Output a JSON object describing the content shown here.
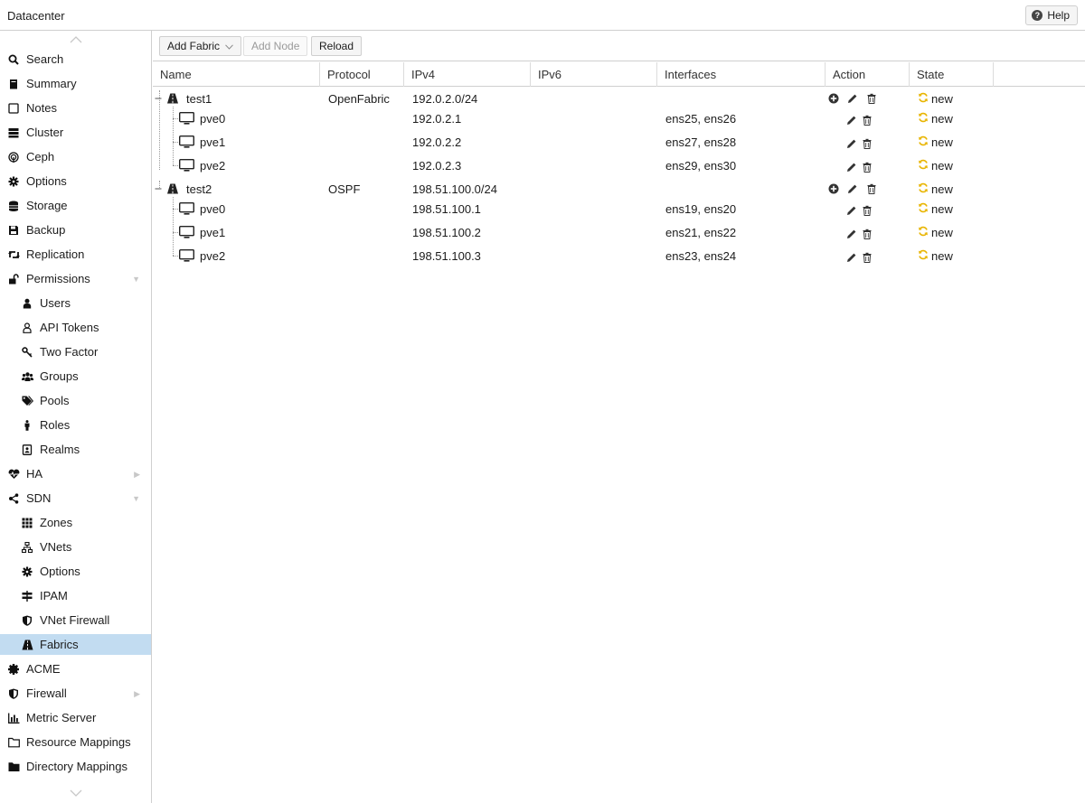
{
  "header": {
    "title": "Datacenter",
    "help_label": "Help"
  },
  "sidebar": {
    "items": [
      {
        "label": "Search"
      },
      {
        "label": "Summary"
      },
      {
        "label": "Notes"
      },
      {
        "label": "Cluster"
      },
      {
        "label": "Ceph"
      },
      {
        "label": "Options"
      },
      {
        "label": "Storage"
      },
      {
        "label": "Backup"
      },
      {
        "label": "Replication"
      },
      {
        "label": "Permissions"
      },
      {
        "label": "Users"
      },
      {
        "label": "API Tokens"
      },
      {
        "label": "Two Factor"
      },
      {
        "label": "Groups"
      },
      {
        "label": "Pools"
      },
      {
        "label": "Roles"
      },
      {
        "label": "Realms"
      },
      {
        "label": "HA"
      },
      {
        "label": "SDN"
      },
      {
        "label": "Zones"
      },
      {
        "label": "VNets"
      },
      {
        "label": "Options"
      },
      {
        "label": "IPAM"
      },
      {
        "label": "VNet Firewall"
      },
      {
        "label": "Fabrics"
      },
      {
        "label": "ACME"
      },
      {
        "label": "Firewall"
      },
      {
        "label": "Metric Server"
      },
      {
        "label": "Resource Mappings"
      },
      {
        "label": "Directory Mappings"
      }
    ]
  },
  "toolbar": {
    "add_fabric": "Add Fabric",
    "add_node": "Add Node",
    "reload": "Reload"
  },
  "grid": {
    "columns": [
      "Name",
      "Protocol",
      "IPv4",
      "IPv6",
      "Interfaces",
      "Action",
      "State"
    ],
    "rows": [
      {
        "name": "test1",
        "protocol": "OpenFabric",
        "ipv4": "192.0.2.0/24",
        "ipv6": "",
        "interfaces": "",
        "state": "new"
      },
      {
        "name": "pve0",
        "protocol": "",
        "ipv4": "192.0.2.1",
        "ipv6": "",
        "interfaces": "ens25, ens26",
        "state": "new"
      },
      {
        "name": "pve1",
        "protocol": "",
        "ipv4": "192.0.2.2",
        "ipv6": "",
        "interfaces": "ens27, ens28",
        "state": "new"
      },
      {
        "name": "pve2",
        "protocol": "",
        "ipv4": "192.0.2.3",
        "ipv6": "",
        "interfaces": "ens29, ens30",
        "state": "new"
      },
      {
        "name": "test2",
        "protocol": "OSPF",
        "ipv4": "198.51.100.0/24",
        "ipv6": "",
        "interfaces": "",
        "state": "new"
      },
      {
        "name": "pve0",
        "protocol": "",
        "ipv4": "198.51.100.1",
        "ipv6": "",
        "interfaces": "ens19, ens20",
        "state": "new"
      },
      {
        "name": "pve1",
        "protocol": "",
        "ipv4": "198.51.100.2",
        "ipv6": "",
        "interfaces": "ens21, ens22",
        "state": "new"
      },
      {
        "name": "pve2",
        "protocol": "",
        "ipv4": "198.51.100.3",
        "ipv6": "",
        "interfaces": "ens23, ens24",
        "state": "new"
      }
    ]
  },
  "colors": {
    "selected": "#c2dcf1",
    "state_icon": "#e8b400"
  }
}
